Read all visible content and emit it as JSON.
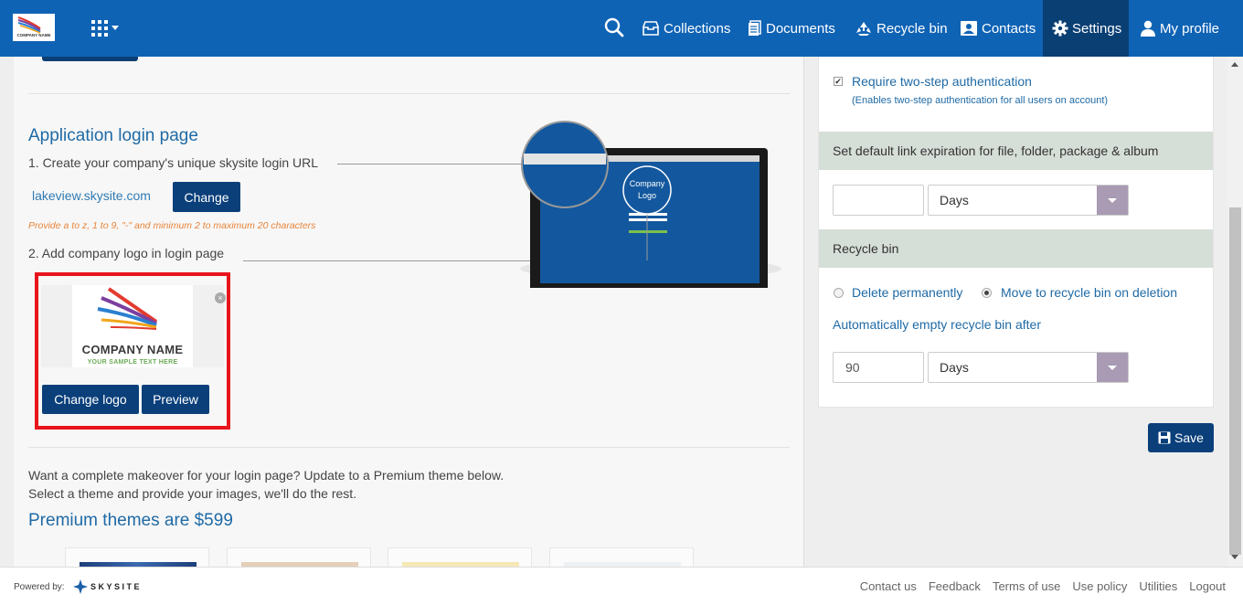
{
  "header": {
    "logo_text": "COMPANY NAME",
    "nav": [
      {
        "label": "Collections",
        "icon": "inbox-tray-icon"
      },
      {
        "label": "Documents",
        "icon": "documents-icon"
      },
      {
        "label": "Recycle bin",
        "icon": "recycle-icon"
      },
      {
        "label": "Contacts",
        "icon": "contact-card-icon"
      },
      {
        "label": "Settings",
        "icon": "gear-icon",
        "active": true
      },
      {
        "label": "My profile",
        "icon": "user-icon"
      }
    ],
    "colors": {
      "bar": "#0f63b5",
      "active": "#0a3f74"
    }
  },
  "login_page": {
    "title": "Application login page",
    "step1": "1. Create your company's unique skysite login URL",
    "url": "lakeview.skysite.com",
    "change_button": "Change",
    "hint": "Provide a to z, 1 to 9, \"-\" and minimum 2 to maximum 20 characters",
    "step2": "2. Add company logo in login page",
    "logo": {
      "name": "COMPANY NAME",
      "subtext": "YOUR SAMPLE TEXT HERE",
      "close_glyph": "×"
    },
    "change_logo_button": "Change logo",
    "preview_button": "Preview",
    "illustration_label_1": "Company",
    "illustration_label_2": "Logo",
    "makeover_line1": "Want a complete makeover for your login page? Update to a Premium theme below.",
    "makeover_line2": "Select a theme and provide your images, we'll do the rest.",
    "premium_title": "Premium themes are $599"
  },
  "security": {
    "two_step_label": "Require two-step authentication",
    "two_step_checked": true,
    "two_step_sub": "(Enables two-step authentication for all users on account)"
  },
  "link_expiration": {
    "title": "Set default link expiration for file, folder, package & album",
    "value": "",
    "unit": "Days"
  },
  "recycle_bin": {
    "title": "Recycle bin",
    "option_delete": "Delete permanently",
    "option_move": "Move to recycle bin on deletion",
    "selected": "move",
    "auto_empty_label": "Automatically empty recycle bin after",
    "auto_empty_value": "90",
    "auto_empty_unit": "Days"
  },
  "save_button": "Save",
  "footer": {
    "powered_by": "Powered by:",
    "brand": "SKYSITE",
    "links": [
      "Contact us",
      "Feedback",
      "Terms of use",
      "Use policy",
      "Utilities",
      "Logout"
    ]
  }
}
